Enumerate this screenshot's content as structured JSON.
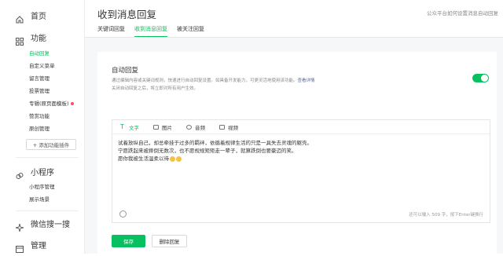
{
  "sidebar": {
    "home": "首页",
    "features": "功能",
    "feature_items": [
      "自动回复",
      "自定义菜单",
      "留言管理",
      "投票管理",
      "专辑(原页面模板)",
      "赞赏功能",
      "原创管理"
    ],
    "add_plugin": "+ 添加功能插件",
    "miniprogram": "小程序",
    "miniprogram_items": [
      "小程序管理",
      "展示场景"
    ],
    "search": "微信搜一搜",
    "manage": "管理"
  },
  "header": {
    "title": "收到消息回复",
    "help_link": "公众平台如何设置消息自动回复"
  },
  "tabs": [
    "关键词回复",
    "收到消息回复",
    "被关注回复"
  ],
  "auto_reply": {
    "title": "自动回复",
    "desc_line1": "通过编辑内容或关键词规则，快速进行自动回复设置。如具备开发能力，可更灵活地使用该功能。",
    "desc_link": "查看详情",
    "desc_line2": "关闭自动回复之后，将立即对所有用户生效。",
    "enabled": true
  },
  "editor": {
    "tabs": [
      "文字",
      "图片",
      "音频",
      "视频"
    ],
    "lines": [
      "试着放纵自己，却总牵挂于过多的羁绊，依循着规律生活的只是一具失去灵魂的躯壳。",
      "宁愿跌起来被摔倒无数次，也不愿规规矩矩走一辈子，就算跌倒也要豪迈的笑。",
      "愿你我被生活温柔以待"
    ],
    "counter": "还可以输入 509 字，按下Enter键换行"
  },
  "buttons": {
    "save": "保存",
    "delete": "删除回复"
  },
  "colors": {
    "accent": "#07c160",
    "link": "#576b95",
    "alert": "#fa5151"
  }
}
